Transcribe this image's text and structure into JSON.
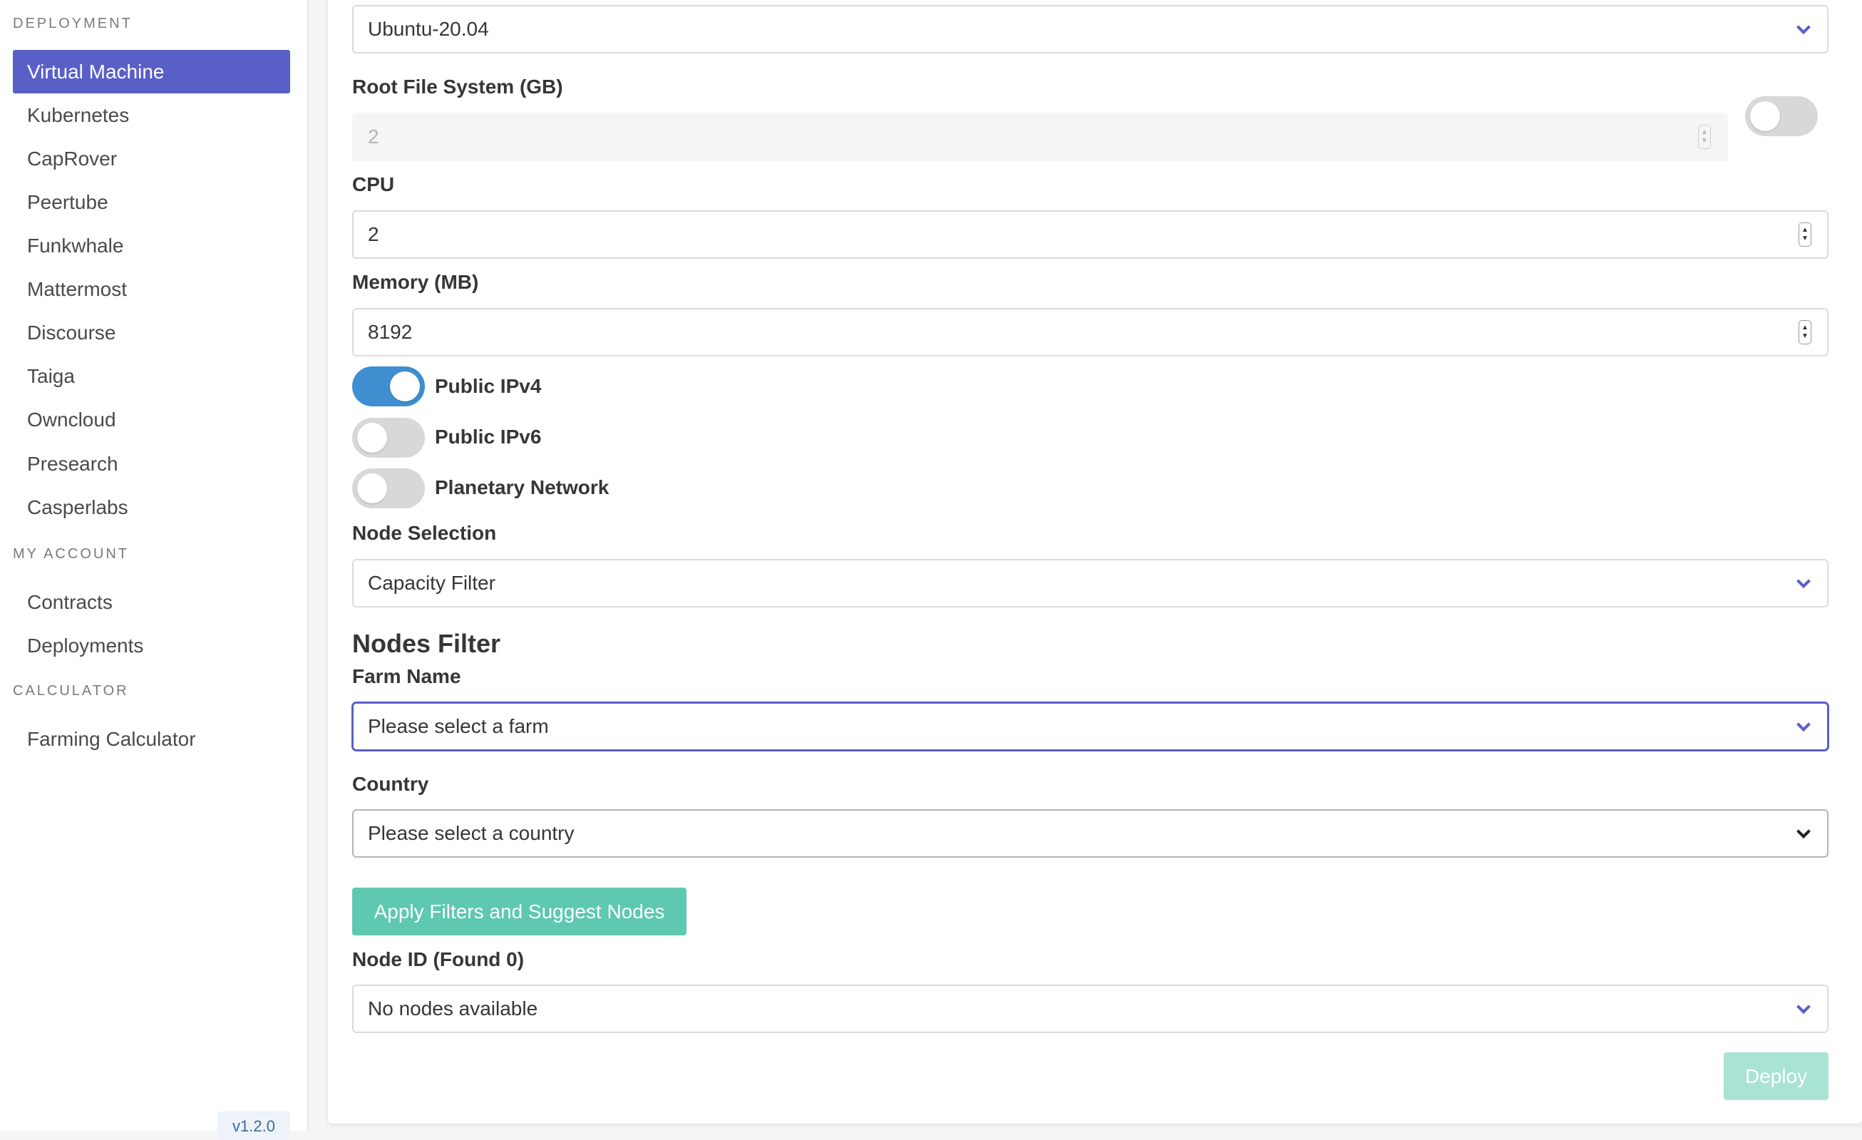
{
  "sidebar": {
    "sections": [
      {
        "label": "DEPLOYMENT",
        "items": [
          "Virtual Machine",
          "Kubernetes",
          "CapRover",
          "Peertube",
          "Funkwhale",
          "Mattermost",
          "Discourse",
          "Taiga",
          "Owncloud",
          "Presearch",
          "Casperlabs"
        ]
      },
      {
        "label": "MY ACCOUNT",
        "items": [
          "Contracts",
          "Deployments"
        ]
      },
      {
        "label": "CALCULATOR",
        "items": [
          "Farming Calculator"
        ]
      }
    ],
    "active_item": "Virtual Machine",
    "version": "v1.2.0"
  },
  "form": {
    "image_select": {
      "value": "Ubuntu-20.04"
    },
    "root_fs": {
      "label": "Root File System (GB)",
      "value": "2",
      "toggle_on": false
    },
    "cpu": {
      "label": "CPU",
      "value": "2"
    },
    "memory": {
      "label": "Memory (MB)",
      "value": "8192"
    },
    "public_ipv4": {
      "label": "Public IPv4",
      "on": true
    },
    "public_ipv6": {
      "label": "Public IPv6",
      "on": false
    },
    "planetary": {
      "label": "Planetary Network",
      "on": false
    },
    "node_selection": {
      "label": "Node Selection",
      "value": "Capacity Filter"
    },
    "nodes_filter": {
      "title": "Nodes Filter",
      "farm": {
        "label": "Farm Name",
        "value": "Please select a farm"
      },
      "country": {
        "label": "Country",
        "value": "Please select a country"
      },
      "apply_label": "Apply Filters and Suggest Nodes"
    },
    "node_id": {
      "label": "Node ID (Found 0)",
      "value": "No nodes available"
    },
    "deploy_label": "Deploy"
  },
  "colors": {
    "accent": "#5a5fc8",
    "toggle_on": "#3e8ed0",
    "primary_button": "#5ec8b0"
  }
}
